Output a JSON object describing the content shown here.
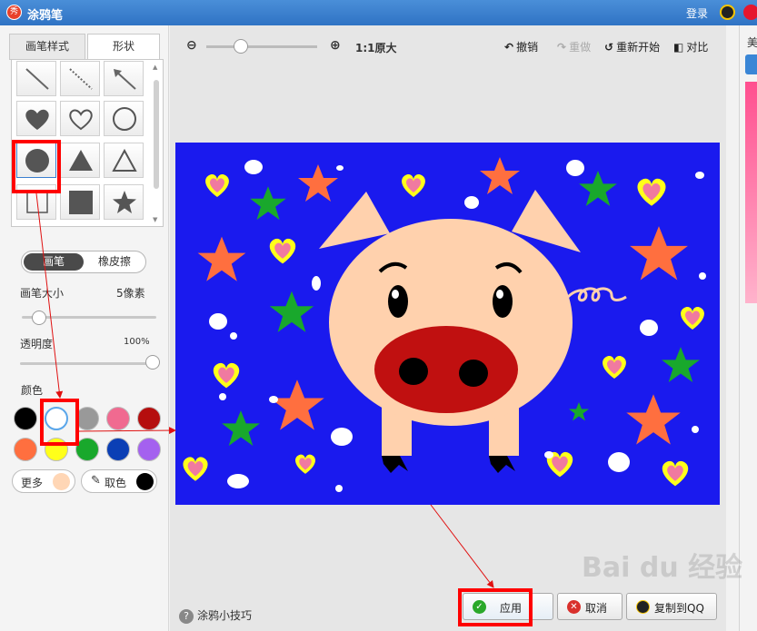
{
  "window": {
    "title": "涂鸦笔",
    "login_label": "登录"
  },
  "left_panel": {
    "tabs": [
      {
        "label": "画笔样式"
      },
      {
        "label": "形状"
      }
    ],
    "brush_mode": {
      "brush_label": "画笔",
      "eraser_label": "橡皮擦"
    },
    "brush_size": {
      "label": "画笔大小",
      "value": "5像素",
      "slider_fraction": 0.05
    },
    "opacity": {
      "label": "透明度",
      "value": "100%",
      "slider_fraction": 1.0
    },
    "color_label": "颜色",
    "swatches": [
      "#000000",
      "#ffffff",
      "#999999",
      "#f06a90",
      "#b50e0e",
      "#ff6f3f",
      "#ffff1a",
      "#19a82c",
      "#0b3fb5",
      "#a461ef"
    ],
    "more_label": "更多",
    "more_color": "#ffd6b5",
    "pick_label": "取色",
    "pick_color": "#000000"
  },
  "toolbar": {
    "zoom_ratio": "1:1",
    "zoom_ratio_label": "原大",
    "undo": "撤销",
    "redo": "重做",
    "restart": "重新开始",
    "compare": "对比"
  },
  "footer": {
    "tips": "涂鸦小技巧",
    "apply": "应用",
    "cancel": "取消",
    "copy_to_qq": "复制到QQ"
  },
  "right_strip": {
    "label": "美"
  },
  "watermark": "Bai du 经验"
}
